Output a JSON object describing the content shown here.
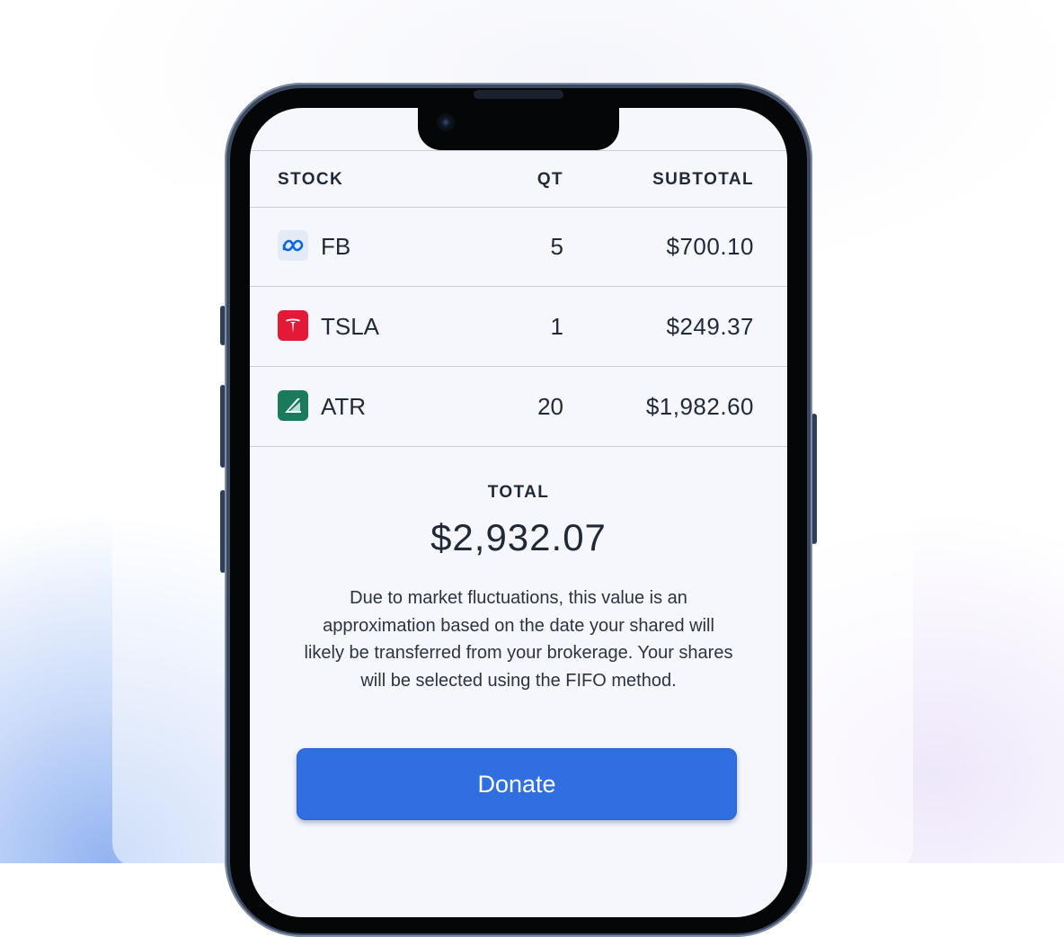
{
  "table": {
    "headers": {
      "stock": "STOCK",
      "qty": "QT",
      "subtotal": "SUBTOTAL"
    },
    "rows": [
      {
        "ticker": "FB",
        "qty": "5",
        "subtotal": "$700.10",
        "icon": "meta-logo-icon"
      },
      {
        "ticker": "TSLA",
        "qty": "1",
        "subtotal": "$249.37",
        "icon": "tesla-logo-icon"
      },
      {
        "ticker": "ATR",
        "qty": "20",
        "subtotal": "$1,982.60",
        "icon": "atr-logo-icon"
      }
    ]
  },
  "summary": {
    "total_label": "TOTAL",
    "total_value": "$2,932.07",
    "disclaimer": "Due to market fluctuations, this value is an approximation based on the date your shared will likely be transferred from your brokerage. Your shares will be selected using the FIFO method."
  },
  "actions": {
    "donate_label": "Donate"
  },
  "colors": {
    "accent": "#2f6fe0",
    "tesla": "#e31937",
    "atr": "#1a7a5c",
    "meta": "#0668e1"
  }
}
